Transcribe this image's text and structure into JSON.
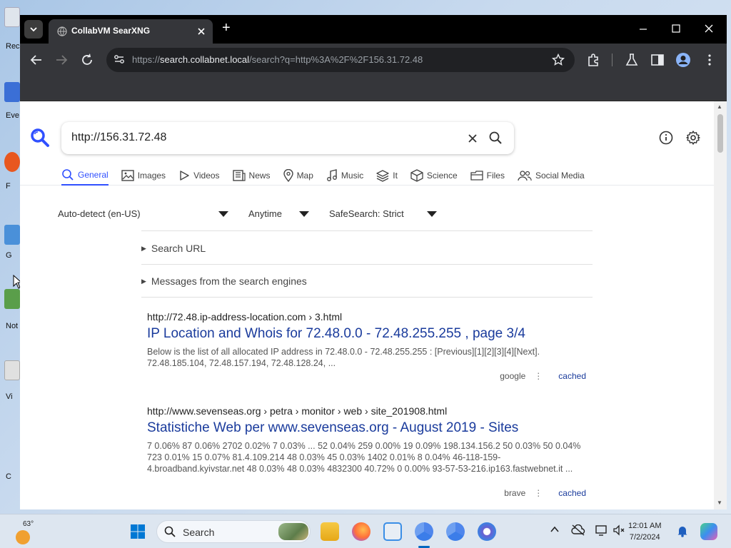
{
  "desktop": {
    "icon_labels": [
      "Rec",
      "Eve",
      "F",
      "G",
      "Not",
      "Vi",
      "C"
    ]
  },
  "browser": {
    "tab_title": "CollabVM SearXNG",
    "new_tab": "+",
    "url_scheme": "https://",
    "url_host": "search.collabnet.local",
    "url_path": "/search?q=http%3A%2F%2F156.31.72.48"
  },
  "search": {
    "query": "http://156.31.72.48",
    "categories": [
      "General",
      "Images",
      "Videos",
      "News",
      "Map",
      "Music",
      "It",
      "Science",
      "Files",
      "Social Media"
    ],
    "active_category": "General",
    "filters": {
      "language": "Auto-detect (en-US)",
      "time": "Anytime",
      "safesearch": "SafeSearch: Strict"
    },
    "search_url_label": "Search URL",
    "engine_messages_label": "Messages from the search engines"
  },
  "results": [
    {
      "url": "http://72.48.ip-address-location.com  › 3.html",
      "title": "IP Location and Whois for 72.48.0.0 - 72.48.255.255 , page 3/4",
      "snippet": "Below is the list of all allocated IP address in 72.48.0.0 - 72.48.255.255 : [Previous][1][2][3][4][Next]. 72.48.185.104, 72.48.157.194, 72.48.128.24, ...",
      "engine": "google",
      "cached": "cached"
    },
    {
      "url": "http://www.sevenseas.org  › petra › monitor › web › site_201908.html",
      "title": "Statistiche Web per www.sevenseas.org - August 2019 - Sites",
      "snippet": "7 0.06% 87 0.06% 2702 0.02% 7 0.03% ... 52 0.04% 259 0.00% 19 0.09% 198.134.156.2 50 0.03% 50 0.04% 723 0.01% 15 0.07% 81.4.109.214 48 0.03% 45 0.03% 1402 0.01% 8 0.04% 46-118-159-4.broadband.kyivstar.net 48 0.03% 48 0.03% 4832300 40.72% 0 0.00% 93-57-53-216.ip163.fastwebnet.it ...",
      "engine": "brave",
      "cached": "cached"
    }
  ],
  "taskbar": {
    "weather_temp": "63°",
    "search_label": "Search",
    "time": "12:01 AM",
    "date": "7/2/2024"
  },
  "colors": {
    "accent": "#3050ff",
    "result_title": "#1a3b9c",
    "chrome_dark": "#35363a"
  }
}
